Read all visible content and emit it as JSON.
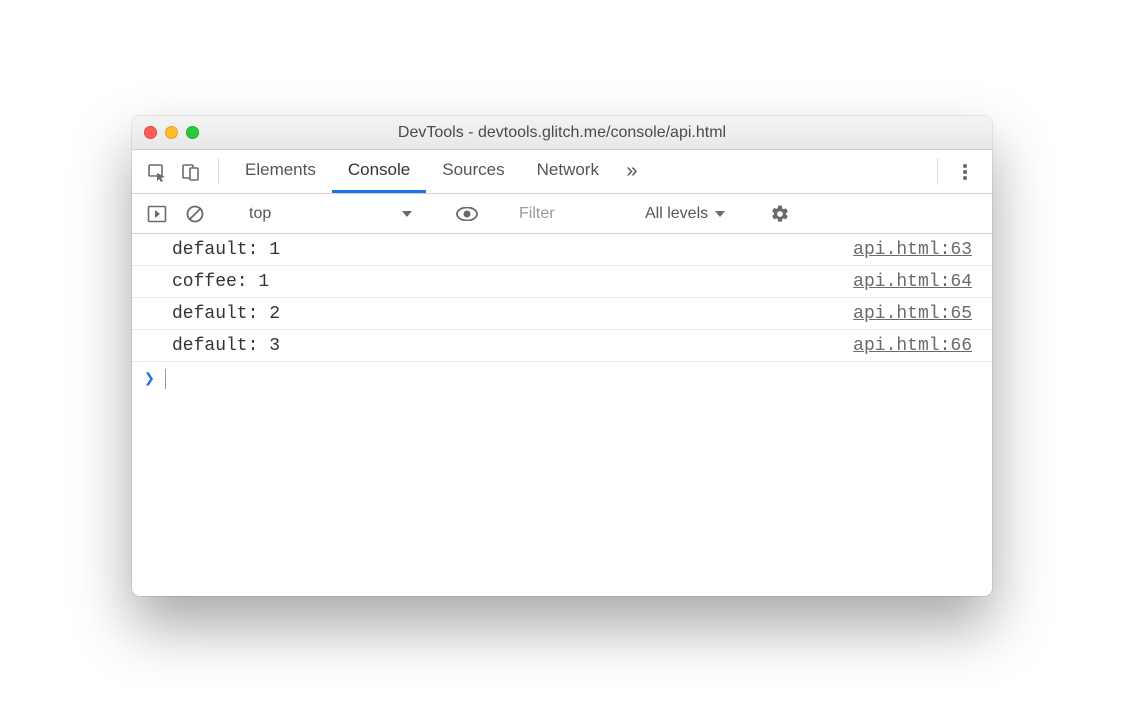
{
  "window": {
    "title": "DevTools - devtools.glitch.me/console/api.html"
  },
  "tabs": {
    "items": [
      "Elements",
      "Console",
      "Sources",
      "Network"
    ],
    "active": "Console",
    "more_glyph": "»"
  },
  "filterbar": {
    "context": "top",
    "filter_placeholder": "Filter",
    "levels_label": "All levels"
  },
  "console": {
    "rows": [
      {
        "message": "default: 1",
        "source": "api.html:63"
      },
      {
        "message": "coffee: 1",
        "source": "api.html:64"
      },
      {
        "message": "default: 2",
        "source": "api.html:65"
      },
      {
        "message": "default: 3",
        "source": "api.html:66"
      }
    ],
    "prompt_glyph": "❯"
  }
}
